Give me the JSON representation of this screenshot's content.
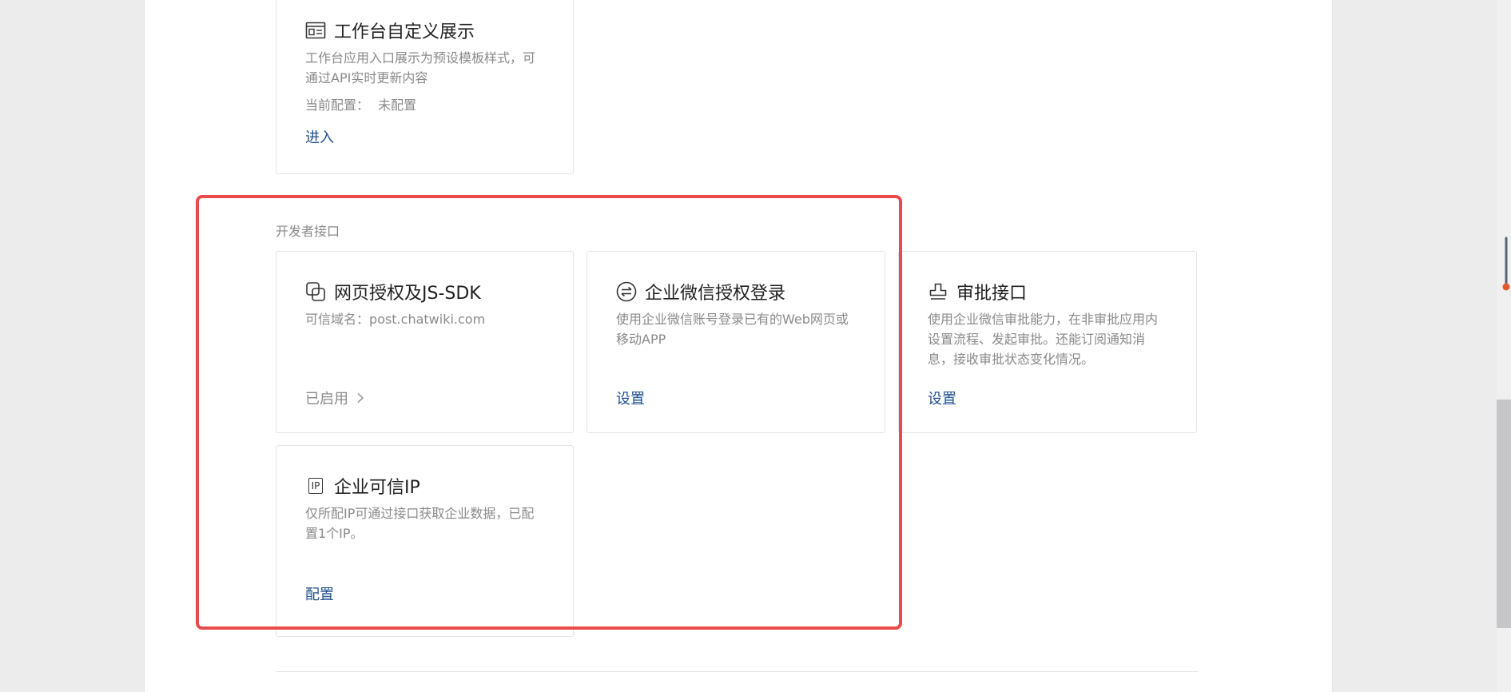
{
  "cards": {
    "workbench": {
      "title": "工作台自定义展示",
      "desc": "工作台应用入口展示为预设模板样式，可通过API实时更新内容",
      "config_label": "当前配置：",
      "config_value": "未配置",
      "action": "进入",
      "icon": "card-layout-icon"
    },
    "web_auth": {
      "title": "网页授权及JS-SDK",
      "desc": "可信域名：post.chatwiki.com",
      "status": "已启用",
      "icon": "overlap-squares-icon"
    },
    "wechat_login": {
      "title": "企业微信授权登录",
      "desc": "使用企业微信账号登录已有的Web网页或移动APP",
      "action": "设置",
      "icon": "exchange-circle-icon"
    },
    "approval": {
      "title": "审批接口",
      "desc": "使用企业微信审批能力，在非审批应用内设置流程、发起审批。还能订阅通知消息，接收审批状态变化情况。",
      "action": "设置",
      "icon": "stamp-icon"
    },
    "trusted_ip": {
      "title": "企业可信IP",
      "desc": "仅所配IP可通过接口获取企业数据，已配置1个IP。",
      "action": "配置",
      "icon_text": "IP",
      "icon": "ip-icon"
    }
  },
  "section": {
    "title": "开发者接口"
  },
  "colors": {
    "link": "#1f4f8f",
    "highlight": "#e94b4b",
    "muted": "#8a8a8a"
  }
}
